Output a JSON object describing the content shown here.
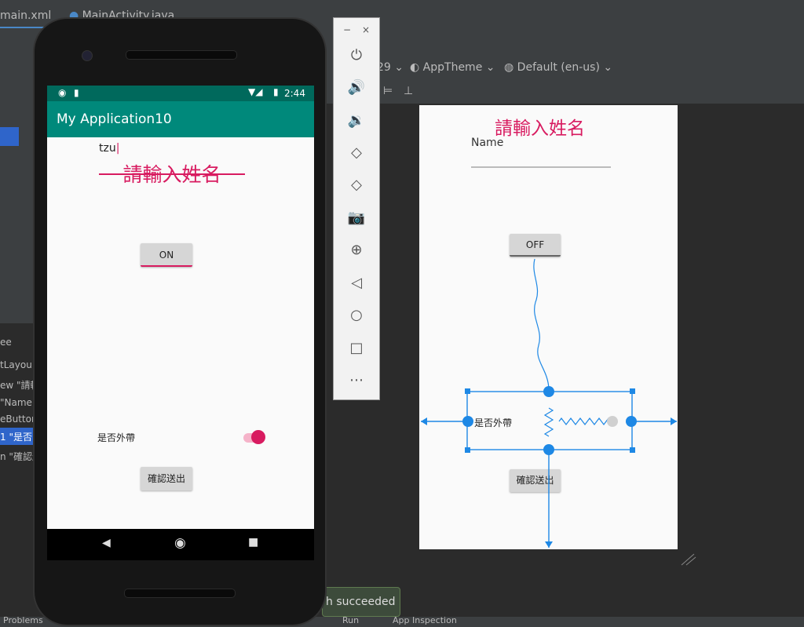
{
  "ide": {
    "tabs": [
      {
        "label": "main.xml"
      },
      {
        "label": "MainActivity.java"
      }
    ],
    "toolbar": {
      "api": "29",
      "theme": "AppTheme",
      "locale": "Default (en-us)"
    },
    "tree": [
      "ee",
      "tLayou",
      "ew \"請輸",
      "\"Name\"",
      "eButton",
      "1 \"是否",
      "n \"確認送"
    ],
    "toast": "h succeeded",
    "bottom": {
      "problems": "Problems",
      "run": "Run",
      "app_inspection": "App Inspection"
    }
  },
  "phone": {
    "status_time": "2:44",
    "app_title": "My Application10",
    "input_value": "tzu",
    "heading": "請輸入姓名",
    "toggle_button": "ON",
    "switch_label": "是否外帶",
    "submit_button": "確認送出"
  },
  "emulator_panel": {
    "buttons": [
      "power-icon",
      "volume-up-icon",
      "volume-down-icon",
      "rotate-left-icon",
      "rotate-right-icon",
      "camera-icon",
      "zoom-icon",
      "back-icon",
      "home-icon",
      "overview-icon",
      "more-icon"
    ]
  },
  "design": {
    "heading": "請輸入姓名",
    "name_hint": "Name",
    "toggle_button": "OFF",
    "switch_label": "是否外帶",
    "submit_button": "確認送出"
  },
  "colors": {
    "accent": "#d81b60",
    "primary": "#00897b",
    "primary_dark": "#00695c",
    "blueprint": "#1e88e5"
  }
}
